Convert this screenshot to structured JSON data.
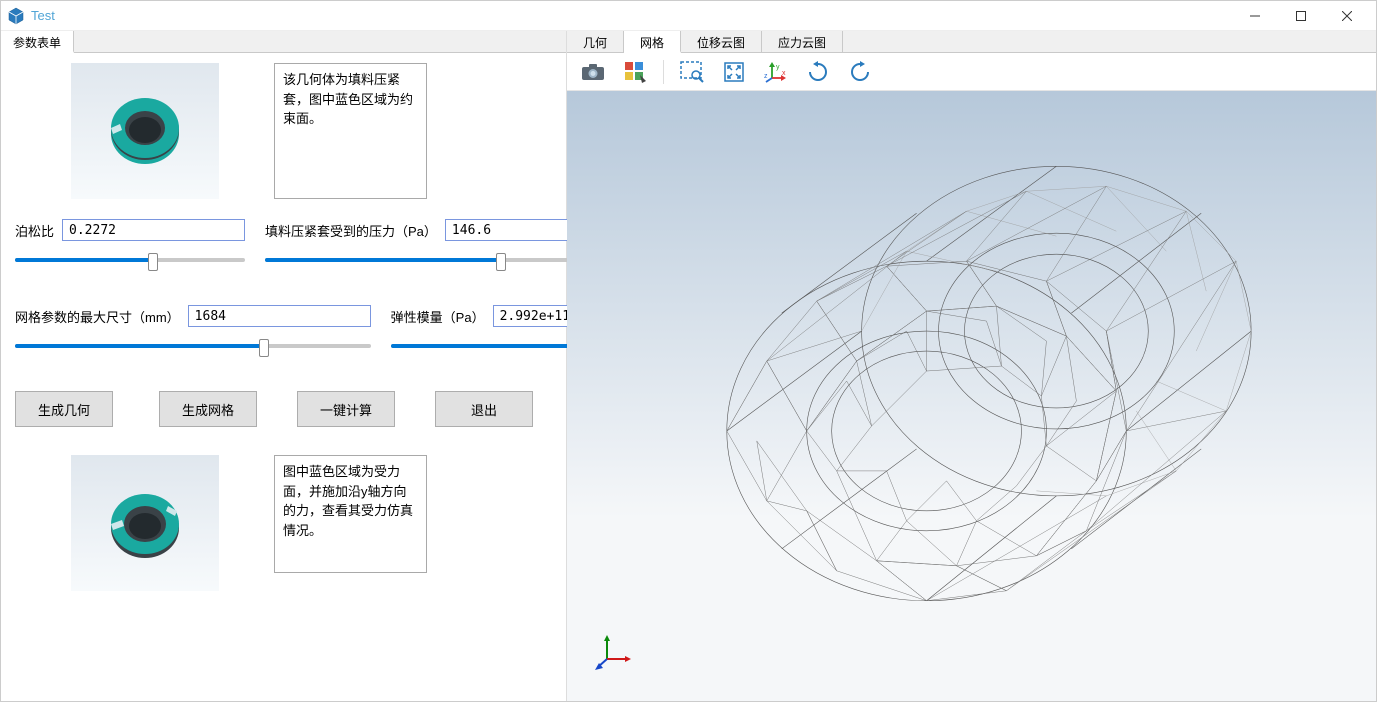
{
  "window": {
    "title": "Test"
  },
  "left": {
    "tab": "参数表单",
    "desc1": "该几何体为填料压紧套，图中蓝色区域为约束面。",
    "desc2": "图中蓝色区域为受力面，并施加沿y轴方向的力，查看其受力仿真情况。",
    "poisson_label": "泊松比",
    "poisson_value": "0.2272",
    "pressure_label": "填料压紧套受到的压力（Pa）",
    "pressure_value": "146.6",
    "meshsize_label": "网格参数的最大尺寸（mm）",
    "meshsize_value": "1684",
    "modulus_label": "弹性模量（Pa）",
    "modulus_value": "2.992e+11",
    "btn_geom": "生成几何",
    "btn_mesh": "生成网格",
    "btn_calc": "一键计算",
    "btn_exit": "退出"
  },
  "right": {
    "tab_geom": "几何",
    "tab_mesh": "网格",
    "tab_disp": "位移云图",
    "tab_stress": "应力云图",
    "active_tab": "网格",
    "icons": {
      "camera": "camera-icon",
      "colors": "color-palette-icon",
      "zoom_window": "zoom-window-icon",
      "fit": "fit-view-icon",
      "axes": "axes-triad-icon",
      "rotate_cw": "rotate-cw-icon",
      "rotate_ccw": "rotate-ccw-icon"
    }
  }
}
